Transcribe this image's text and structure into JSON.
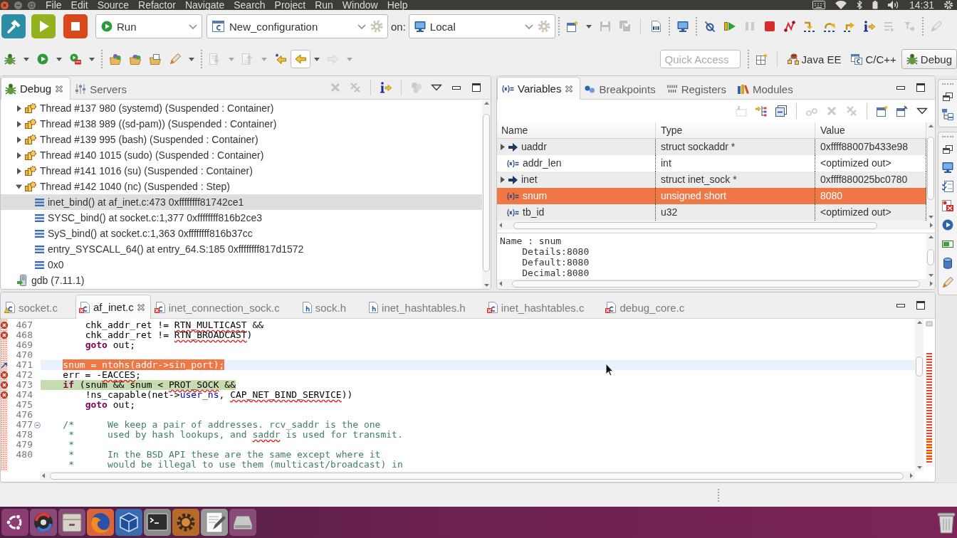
{
  "menubar": {
    "menus": [
      "File",
      "Edit",
      "Source",
      "Refactor",
      "Navigate",
      "Search",
      "Project",
      "Run",
      "Window",
      "Help"
    ],
    "clock": "14:31"
  },
  "toolbar": {
    "launch_mode": "Run",
    "launch_configuration": "New_configuration",
    "target_label": "on:",
    "launch_target": "Local",
    "buttons": [
      {
        "kind": "new_config",
        "disabled": false
      },
      {
        "kind": "caret",
        "disabled": false
      },
      {
        "kind": "save",
        "disabled": true
      },
      {
        "kind": "save_all",
        "disabled": true
      },
      {
        "kind": "separator"
      },
      {
        "kind": "binary",
        "disabled": false
      },
      {
        "kind": "grip"
      },
      {
        "kind": "monitor",
        "disabled": false
      },
      {
        "kind": "grip"
      },
      {
        "kind": "skip_breakpoints",
        "disabled": false
      },
      {
        "kind": "resume",
        "disabled": false
      },
      {
        "kind": "suspend",
        "disabled": true
      },
      {
        "kind": "terminate",
        "disabled": false
      },
      {
        "kind": "disconnect",
        "disabled": false
      },
      {
        "kind": "step_into",
        "disabled": false
      },
      {
        "kind": "step_over",
        "disabled": false
      },
      {
        "kind": "step_return",
        "disabled": false
      },
      {
        "kind": "instruction_step",
        "disabled": false
      },
      {
        "kind": "drop_frame",
        "disabled": true
      },
      {
        "kind": "step_filters",
        "disabled": true
      },
      {
        "kind": "grip"
      },
      {
        "kind": "pen",
        "disabled": true
      }
    ],
    "navigation_buttons": [
      {
        "kind": "debug",
        "disabled": false,
        "pressed": false
      },
      {
        "kind": "caret",
        "disabled": false
      },
      {
        "kind": "run",
        "disabled": false,
        "pressed": false
      },
      {
        "kind": "caret",
        "disabled": false
      },
      {
        "kind": "external_tools",
        "disabled": false,
        "pressed": false
      },
      {
        "kind": "caret",
        "disabled": false
      },
      {
        "kind": "grip"
      },
      {
        "kind": "open_type",
        "disabled": false,
        "pressed": false
      },
      {
        "kind": "open_element",
        "disabled": false,
        "pressed": false
      },
      {
        "kind": "open_task",
        "disabled": false,
        "pressed": false
      },
      {
        "kind": "pen",
        "disabled": false,
        "pressed": false
      },
      {
        "kind": "caret",
        "disabled": false
      },
      {
        "kind": "grip"
      },
      {
        "kind": "next_annotation",
        "disabled": true,
        "pressed": false
      },
      {
        "kind": "caret",
        "disabled": true
      },
      {
        "kind": "prev_annotation",
        "disabled": true,
        "pressed": false
      },
      {
        "kind": "caret",
        "disabled": true
      },
      {
        "kind": "last_edit",
        "disabled": false,
        "pressed": false
      },
      {
        "kind": "back",
        "disabled": false,
        "pressed": true
      },
      {
        "kind": "caret",
        "disabled": false
      },
      {
        "kind": "forward",
        "disabled": true,
        "pressed": false
      },
      {
        "kind": "caret",
        "disabled": true
      }
    ],
    "quick_access": {
      "placeholder": "Quick Access"
    },
    "perspectives": [
      {
        "kind": "java",
        "label": "Java EE",
        "selected": false
      },
      {
        "kind": "cpp",
        "label": "C/C++",
        "selected": false
      },
      {
        "kind": "debug",
        "label": "Debug",
        "selected": true
      }
    ]
  },
  "debug": {
    "tabs": [
      {
        "kind": "debug",
        "label": "Debug",
        "selected": true
      },
      {
        "kind": "servers",
        "label": "Servers",
        "selected": false
      }
    ],
    "toolbar": [
      {
        "kind": "remove_terminated",
        "disabled": true
      },
      {
        "kind": "remove_all",
        "disabled": true
      },
      {
        "kind": "separator"
      },
      {
        "kind": "instruction_step",
        "disabled": false
      },
      {
        "kind": "separator"
      },
      {
        "kind": "group",
        "disabled": true
      },
      {
        "kind": "view_menu"
      }
    ],
    "tree": [
      {
        "kind": "thread",
        "label": "Thread #137 980 (systemd) (Suspended : Container)",
        "expanded": false,
        "selected": false
      },
      {
        "kind": "thread",
        "label": "Thread #138 989 ((sd-pam)) (Suspended : Container)",
        "expanded": false,
        "selected": false
      },
      {
        "kind": "thread",
        "label": "Thread #139 995 (bash) (Suspended : Container)",
        "expanded": false,
        "selected": false
      },
      {
        "kind": "thread",
        "label": "Thread #140 1015 (sudo) (Suspended : Container)",
        "expanded": false,
        "selected": false
      },
      {
        "kind": "thread",
        "label": "Thread #141 1016 (su) (Suspended : Container)",
        "expanded": false,
        "selected": false
      },
      {
        "kind": "thread",
        "label": "Thread #142 1040 (nc) (Suspended : Step)",
        "expanded": true,
        "selected": false,
        "children": [
          {
            "kind": "frame",
            "label": "inet_bind() at af_inet.c:473 0xffffffff81742ce1",
            "selected": true
          },
          {
            "kind": "frame",
            "label": "SYSC_bind() at socket.c:1,377 0xffffffff816b2ce3",
            "selected": false
          },
          {
            "kind": "frame",
            "label": "SyS_bind() at socket.c:1,363 0xffffffff816b37cc",
            "selected": false
          },
          {
            "kind": "frame",
            "label": "entry_SYSCALL_64() at entry_64.S:185 0xffffffff817d1572",
            "selected": false
          },
          {
            "kind": "frame",
            "label": "0x0",
            "selected": false
          }
        ]
      },
      {
        "kind": "debugger",
        "label": "gdb (7.11.1)",
        "selected": false
      }
    ]
  },
  "variables": {
    "tabs": [
      {
        "kind": "variables",
        "label": "Variables",
        "selected": true
      },
      {
        "kind": "breakpoints",
        "label": "Breakpoints",
        "selected": false
      },
      {
        "kind": "registers",
        "label": "Registers",
        "selected": false
      },
      {
        "kind": "modules",
        "label": "Modules",
        "selected": false
      }
    ],
    "toolbar": [
      {
        "kind": "show_type",
        "disabled": true
      },
      {
        "kind": "expand",
        "disabled": false
      },
      {
        "kind": "collapse_all",
        "disabled": false
      },
      {
        "kind": "separator"
      },
      {
        "kind": "watch",
        "disabled": true
      },
      {
        "kind": "remove",
        "disabled": true
      },
      {
        "kind": "remove_all",
        "disabled": true
      },
      {
        "kind": "separator"
      },
      {
        "kind": "new_view",
        "disabled": false
      },
      {
        "kind": "pin",
        "disabled": false
      },
      {
        "kind": "view_menu"
      }
    ],
    "columns": [
      "Name",
      "Type",
      "Value"
    ],
    "rows": [
      {
        "kind": "pointer",
        "name": "uaddr",
        "type": "struct sockaddr *",
        "value": "0xffff88007b433e98",
        "expanded": false,
        "selected": false
      },
      {
        "kind": "scalar",
        "name": "addr_len",
        "type": "int",
        "value": "<optimized out>",
        "selected": false
      },
      {
        "kind": "pointer",
        "name": "inet",
        "type": "struct inet_sock *",
        "value": "0xffff880025bc0780",
        "expanded": false,
        "selected": false
      },
      {
        "kind": "scalar",
        "name": "snum",
        "type": "unsigned short",
        "value": "8080",
        "selected": true
      },
      {
        "kind": "scalar",
        "name": "tb_id",
        "type": "u32",
        "value": "<optimized out>",
        "selected": false
      }
    ],
    "details": {
      "name_line": "Name : snum",
      "entries": [
        "Details:8080",
        "Default:8080",
        "Decimal:8080"
      ]
    }
  },
  "editor": {
    "tabs": [
      {
        "kind": "source",
        "label": "socket.c",
        "has_error": false,
        "has_warning": true,
        "selected": false
      },
      {
        "kind": "source",
        "label": "af_inet.c",
        "has_error": true,
        "has_warning": false,
        "selected": true
      },
      {
        "kind": "source",
        "label": "inet_connection_sock.c",
        "has_error": true,
        "has_warning": false,
        "selected": false
      },
      {
        "kind": "header",
        "label": "sock.h",
        "has_error": false,
        "has_warning": false,
        "selected": false
      },
      {
        "kind": "header",
        "label": "inet_hashtables.h",
        "has_error": false,
        "has_warning": false,
        "selected": false
      },
      {
        "kind": "source",
        "label": "inet_hashtables.c",
        "has_error": true,
        "has_warning": false,
        "selected": false
      },
      {
        "kind": "source",
        "label": "debug_core.c",
        "has_error": true,
        "has_warning": false,
        "selected": false
      }
    ],
    "lines": [
      {
        "number": "467",
        "tokens": [
          {
            "text": "        chk_addr_ret != "
          },
          {
            "text": "RTN_MULTICAST",
            "kind": "error"
          },
          {
            "text": " &&"
          }
        ],
        "current": false,
        "instruction_pointer": false,
        "error_marker": true,
        "arrow_marker": false,
        "foldable": false
      },
      {
        "number": "468",
        "tokens": [
          {
            "text": "        chk_addr_ret != "
          },
          {
            "text": "RTN_BROADCAST",
            "kind": "error"
          },
          {
            "text": ")"
          }
        ],
        "current": false,
        "instruction_pointer": false,
        "error_marker": true,
        "arrow_marker": false,
        "foldable": false
      },
      {
        "number": "469",
        "tokens": [
          {
            "text": "        goto",
            "kind": "keyword"
          },
          {
            "text": " out;"
          }
        ],
        "current": false,
        "instruction_pointer": false,
        "error_marker": false,
        "arrow_marker": false,
        "foldable": false
      },
      {
        "number": "470",
        "current": false,
        "instruction_pointer": false,
        "error_marker": false,
        "arrow_marker": false,
        "foldable": false
      },
      {
        "number": "471",
        "tokens": [
          {
            "text": "    snum = ntohs(addr->sin_port);",
            "kind": "selection"
          }
        ],
        "current": true,
        "instruction_pointer": false,
        "error_marker": false,
        "arrow_marker": true,
        "foldable": false
      },
      {
        "number": "472",
        "tokens": [
          {
            "text": "    err = -"
          },
          {
            "text": "EACCES",
            "kind": "error"
          },
          {
            "text": ";"
          }
        ],
        "current": false,
        "instruction_pointer": false,
        "error_marker": true,
        "arrow_marker": false,
        "foldable": false
      },
      {
        "number": "473",
        "tokens": [
          {
            "text": "    if",
            "kind": "keyword"
          },
          {
            "text": " (snum && snum < "
          },
          {
            "text": "PROT_SOCK",
            "kind": "error"
          },
          {
            "text": " &&"
          }
        ],
        "current": false,
        "instruction_pointer": true,
        "error_marker": true,
        "arrow_marker": false,
        "foldable": false
      },
      {
        "number": "474",
        "tokens": [
          {
            "text": "        !ns_capable(net->"
          },
          {
            "text": "user_ns",
            "kind": "field"
          },
          {
            "text": ", "
          },
          {
            "text": "CAP_NET_BIND_SERVICE",
            "kind": "error"
          },
          {
            "text": "))"
          }
        ],
        "current": false,
        "instruction_pointer": false,
        "error_marker": true,
        "arrow_marker": false,
        "foldable": false
      },
      {
        "number": "475",
        "tokens": [
          {
            "text": "        goto",
            "kind": "keyword"
          },
          {
            "text": " out;"
          }
        ],
        "current": false,
        "instruction_pointer": false,
        "error_marker": false,
        "arrow_marker": false,
        "foldable": false
      },
      {
        "number": "476",
        "current": false,
        "instruction_pointer": false,
        "error_marker": false,
        "arrow_marker": false,
        "foldable": false
      },
      {
        "number": "477",
        "tokens": [
          {
            "text": "    /*      We keep a pair of addresses. rcv_saddr is the one",
            "kind": "comment"
          }
        ],
        "current": false,
        "instruction_pointer": false,
        "error_marker": false,
        "arrow_marker": false,
        "foldable": true
      },
      {
        "number": "478",
        "tokens": [
          {
            "text": "     *      used by hash lookups, and ",
            "kind": "comment"
          },
          {
            "text": "saddr",
            "kind": "spelling"
          },
          {
            "text": " is used for transmit.",
            "kind": "comment"
          }
        ],
        "current": false,
        "instruction_pointer": false,
        "error_marker": false,
        "arrow_marker": false,
        "foldable": false
      },
      {
        "number": "479",
        "tokens": [
          {
            "text": "     *",
            "kind": "comment"
          }
        ],
        "current": false,
        "instruction_pointer": false,
        "error_marker": false,
        "arrow_marker": false,
        "foldable": false
      },
      {
        "number": "480",
        "tokens": [
          {
            "text": "     *      In the BSD API these are the same except where it",
            "kind": "comment"
          }
        ],
        "current": false,
        "instruction_pointer": false,
        "error_marker": false,
        "arrow_marker": false,
        "foldable": false
      },
      {
        "tokens": [
          {
            "text": "     *      would be illegal to use them (multicast/broadcast) in",
            "kind": "comment"
          }
        ],
        "current": false,
        "instruction_pointer": false,
        "error_marker": false,
        "arrow_marker": false,
        "foldable": false
      }
    ]
  }
}
